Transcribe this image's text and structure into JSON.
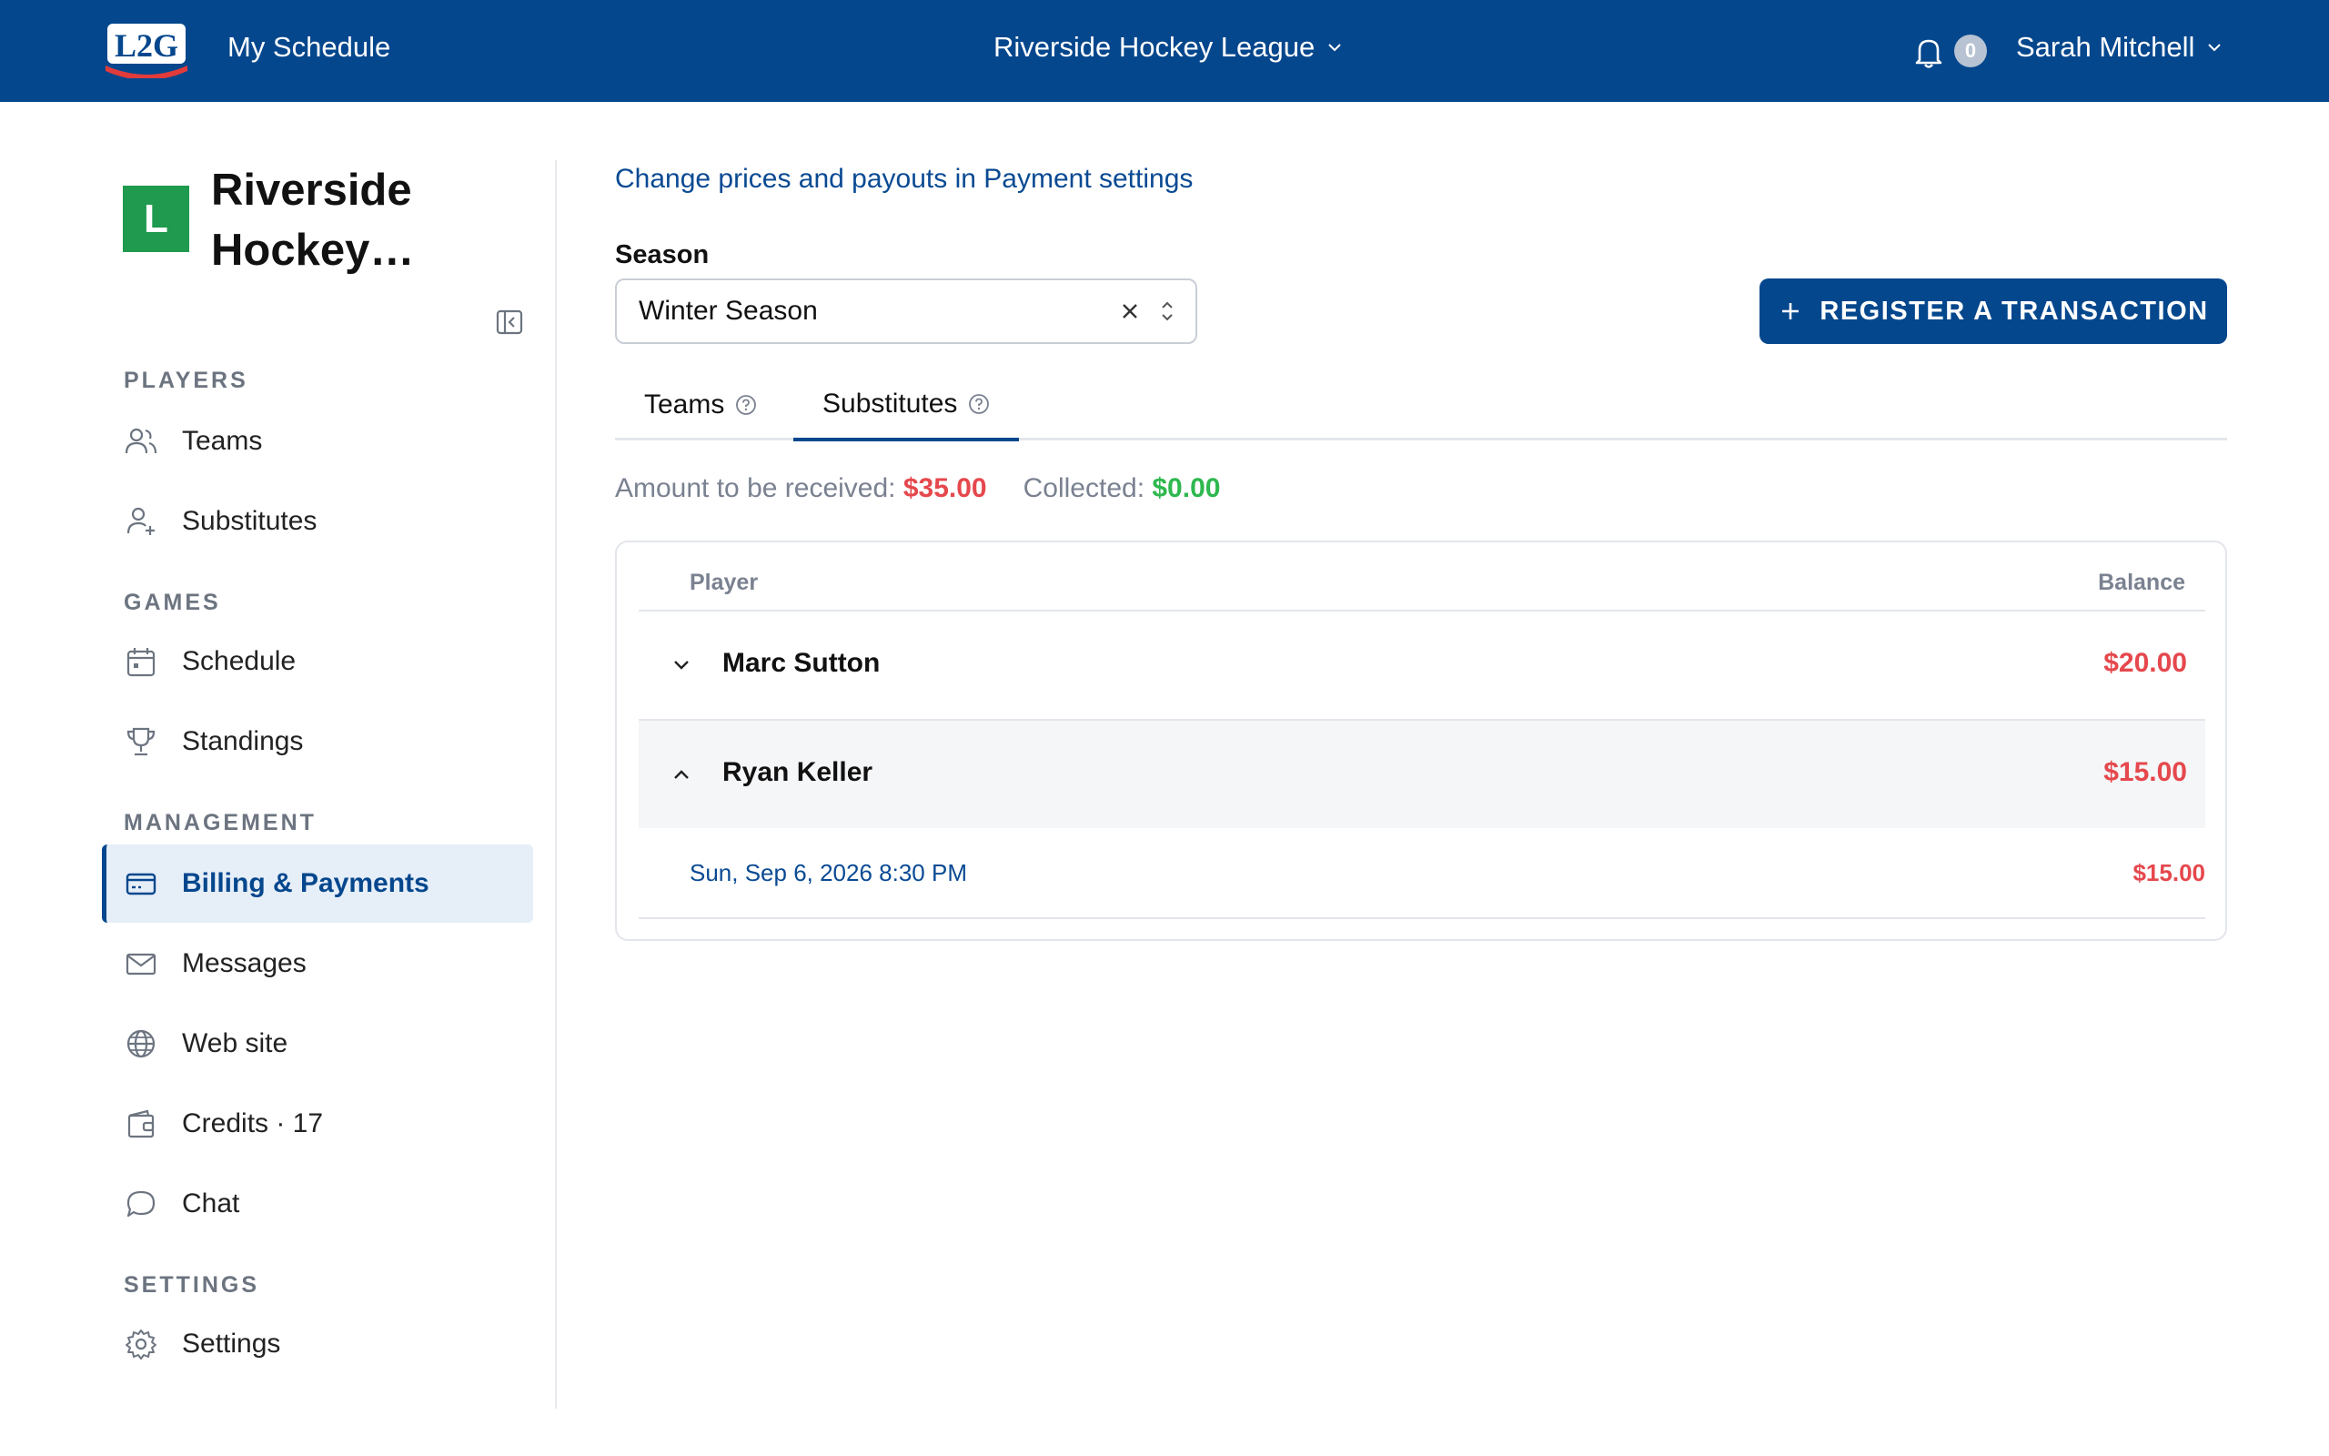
{
  "topbar": {
    "logo_text": "L2G",
    "my_schedule": "My Schedule",
    "league_name": "Riverside Hockey League",
    "notifications_count": "0",
    "user_name": "Sarah Mitchell"
  },
  "sidebar": {
    "avatar_letter": "L",
    "league_title": "Riverside Hockey…",
    "sections": {
      "players": "PLAYERS",
      "games": "GAMES",
      "management": "MANAGEMENT",
      "settings": "SETTINGS"
    },
    "items": {
      "teams": "Teams",
      "substitutes": "Substitutes",
      "schedule": "Schedule",
      "standings": "Standings",
      "billing": "Billing & Payments",
      "messages": "Messages",
      "website": "Web site",
      "credits": "Credits · 17",
      "chat": "Chat",
      "settings": "Settings"
    }
  },
  "main": {
    "settings_link": "Change prices and payouts in Payment settings",
    "season_label": "Season",
    "season_value": "Winter Season",
    "register_button": "REGISTER A TRANSACTION",
    "tabs": {
      "teams": "Teams",
      "substitutes": "Substitutes"
    },
    "summary": {
      "to_receive_label": "Amount to be received:",
      "to_receive_value": "$35.00",
      "collected_label": "Collected:",
      "collected_value": "$0.00"
    },
    "table": {
      "col_player": "Player",
      "col_balance": "Balance",
      "rows": [
        {
          "name": "Marc Sutton",
          "balance": "$20.00"
        },
        {
          "name": "Ryan Keller",
          "balance": "$15.00"
        }
      ],
      "detail": {
        "date": "Sun, Sep 6, 2026 8:30 PM",
        "amount": "$15.00"
      }
    }
  },
  "colors": {
    "brand": "#05478d",
    "amount_due": "#e5484d",
    "collected": "#2eb84f",
    "league_avatar": "#1f9a4f"
  }
}
